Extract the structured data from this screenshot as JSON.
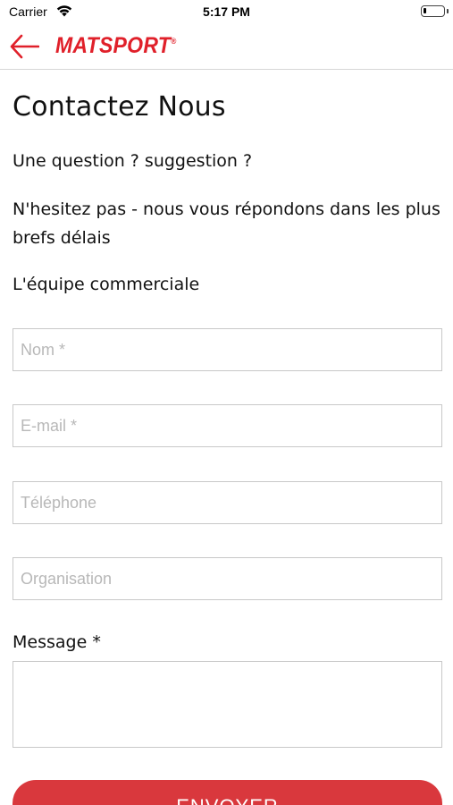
{
  "status_bar": {
    "carrier": "Carrier",
    "time": "5:17 PM",
    "battery_level": 0.15
  },
  "nav": {
    "back_icon": "arrow-left-icon",
    "logo_text": "MATSPORT",
    "logo_mark": "®",
    "accent_color": "#e0202a"
  },
  "page": {
    "title": "Contactez Nous",
    "line1": "Une question ? suggestion ?",
    "line2": "N'hesitez pas - nous vous répondons dans les plus brefs délais",
    "line3": "L'équipe commerciale"
  },
  "form": {
    "name_placeholder": "Nom *",
    "email_placeholder": "E-mail *",
    "phone_placeholder": "Téléphone",
    "org_placeholder": "Organisation",
    "message_label": "Message *",
    "message_value": "",
    "submit_label": "ENVOYER",
    "submit_color": "#d9383d"
  }
}
